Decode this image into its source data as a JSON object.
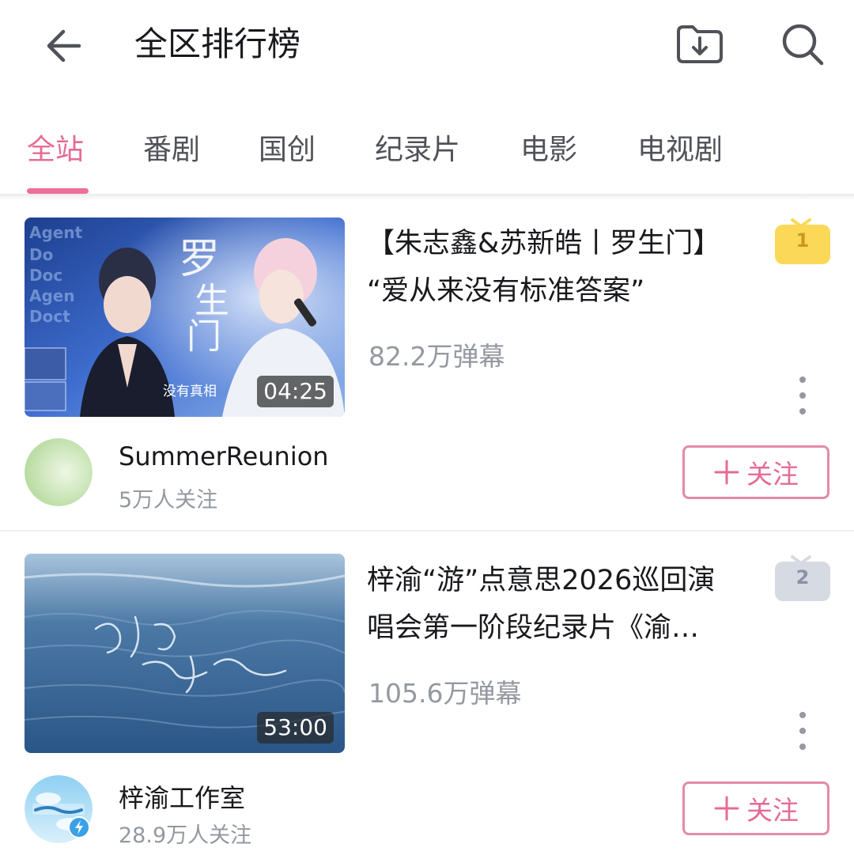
{
  "header": {
    "title": "全区排行榜",
    "back_icon": "back-arrow-icon",
    "download_icon": "download-folder-icon",
    "search_icon": "search-icon"
  },
  "tabs": [
    {
      "label": "全站",
      "active": true
    },
    {
      "label": "番剧",
      "active": false
    },
    {
      "label": "国创",
      "active": false
    },
    {
      "label": "纪录片",
      "active": false
    },
    {
      "label": "电影",
      "active": false
    },
    {
      "label": "电视剧",
      "active": false
    }
  ],
  "colors": {
    "accent": "#e56b95",
    "rank1": "#fbd857",
    "rank2": "#d5dae3"
  },
  "videos": [
    {
      "rank": "1",
      "title_line1": "【朱志鑫&苏新皓丨罗生门】",
      "title_line2": "“爱从来没有标准答案”",
      "danmaku": "82.2万弹幕",
      "duration": "04:25",
      "uploader": "SummerReunion",
      "followers": "5万人关注",
      "follow_label": "关注"
    },
    {
      "rank": "2",
      "title_line1": "梓渝“游”点意思2026巡回演",
      "title_line2": "唱会第一阶段纪录片《渝…",
      "danmaku": "105.6万弹幕",
      "duration": "53:00",
      "uploader": "梓渝工作室",
      "followers": "28.9万人关注",
      "follow_label": "关注"
    }
  ]
}
